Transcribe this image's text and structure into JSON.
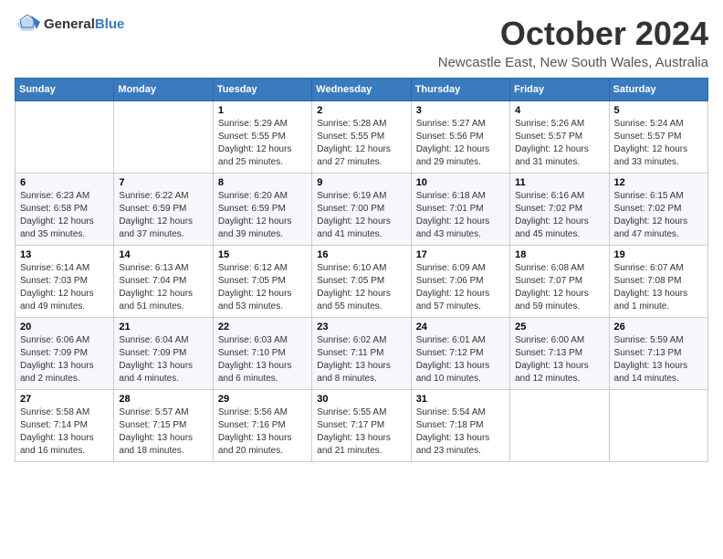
{
  "header": {
    "logo_general": "General",
    "logo_blue": "Blue",
    "month_title": "October 2024",
    "location": "Newcastle East, New South Wales, Australia"
  },
  "columns": [
    "Sunday",
    "Monday",
    "Tuesday",
    "Wednesday",
    "Thursday",
    "Friday",
    "Saturday"
  ],
  "weeks": [
    [
      {
        "day": "",
        "details": ""
      },
      {
        "day": "",
        "details": ""
      },
      {
        "day": "1",
        "details": "Sunrise: 5:29 AM\nSunset: 5:55 PM\nDaylight: 12 hours and 25 minutes."
      },
      {
        "day": "2",
        "details": "Sunrise: 5:28 AM\nSunset: 5:55 PM\nDaylight: 12 hours and 27 minutes."
      },
      {
        "day": "3",
        "details": "Sunrise: 5:27 AM\nSunset: 5:56 PM\nDaylight: 12 hours and 29 minutes."
      },
      {
        "day": "4",
        "details": "Sunrise: 5:26 AM\nSunset: 5:57 PM\nDaylight: 12 hours and 31 minutes."
      },
      {
        "day": "5",
        "details": "Sunrise: 5:24 AM\nSunset: 5:57 PM\nDaylight: 12 hours and 33 minutes."
      }
    ],
    [
      {
        "day": "6",
        "details": "Sunrise: 6:23 AM\nSunset: 6:58 PM\nDaylight: 12 hours and 35 minutes."
      },
      {
        "day": "7",
        "details": "Sunrise: 6:22 AM\nSunset: 6:59 PM\nDaylight: 12 hours and 37 minutes."
      },
      {
        "day": "8",
        "details": "Sunrise: 6:20 AM\nSunset: 6:59 PM\nDaylight: 12 hours and 39 minutes."
      },
      {
        "day": "9",
        "details": "Sunrise: 6:19 AM\nSunset: 7:00 PM\nDaylight: 12 hours and 41 minutes."
      },
      {
        "day": "10",
        "details": "Sunrise: 6:18 AM\nSunset: 7:01 PM\nDaylight: 12 hours and 43 minutes."
      },
      {
        "day": "11",
        "details": "Sunrise: 6:16 AM\nSunset: 7:02 PM\nDaylight: 12 hours and 45 minutes."
      },
      {
        "day": "12",
        "details": "Sunrise: 6:15 AM\nSunset: 7:02 PM\nDaylight: 12 hours and 47 minutes."
      }
    ],
    [
      {
        "day": "13",
        "details": "Sunrise: 6:14 AM\nSunset: 7:03 PM\nDaylight: 12 hours and 49 minutes."
      },
      {
        "day": "14",
        "details": "Sunrise: 6:13 AM\nSunset: 7:04 PM\nDaylight: 12 hours and 51 minutes."
      },
      {
        "day": "15",
        "details": "Sunrise: 6:12 AM\nSunset: 7:05 PM\nDaylight: 12 hours and 53 minutes."
      },
      {
        "day": "16",
        "details": "Sunrise: 6:10 AM\nSunset: 7:05 PM\nDaylight: 12 hours and 55 minutes."
      },
      {
        "day": "17",
        "details": "Sunrise: 6:09 AM\nSunset: 7:06 PM\nDaylight: 12 hours and 57 minutes."
      },
      {
        "day": "18",
        "details": "Sunrise: 6:08 AM\nSunset: 7:07 PM\nDaylight: 12 hours and 59 minutes."
      },
      {
        "day": "19",
        "details": "Sunrise: 6:07 AM\nSunset: 7:08 PM\nDaylight: 13 hours and 1 minute."
      }
    ],
    [
      {
        "day": "20",
        "details": "Sunrise: 6:06 AM\nSunset: 7:09 PM\nDaylight: 13 hours and 2 minutes."
      },
      {
        "day": "21",
        "details": "Sunrise: 6:04 AM\nSunset: 7:09 PM\nDaylight: 13 hours and 4 minutes."
      },
      {
        "day": "22",
        "details": "Sunrise: 6:03 AM\nSunset: 7:10 PM\nDaylight: 13 hours and 6 minutes."
      },
      {
        "day": "23",
        "details": "Sunrise: 6:02 AM\nSunset: 7:11 PM\nDaylight: 13 hours and 8 minutes."
      },
      {
        "day": "24",
        "details": "Sunrise: 6:01 AM\nSunset: 7:12 PM\nDaylight: 13 hours and 10 minutes."
      },
      {
        "day": "25",
        "details": "Sunrise: 6:00 AM\nSunset: 7:13 PM\nDaylight: 13 hours and 12 minutes."
      },
      {
        "day": "26",
        "details": "Sunrise: 5:59 AM\nSunset: 7:13 PM\nDaylight: 13 hours and 14 minutes."
      }
    ],
    [
      {
        "day": "27",
        "details": "Sunrise: 5:58 AM\nSunset: 7:14 PM\nDaylight: 13 hours and 16 minutes."
      },
      {
        "day": "28",
        "details": "Sunrise: 5:57 AM\nSunset: 7:15 PM\nDaylight: 13 hours and 18 minutes."
      },
      {
        "day": "29",
        "details": "Sunrise: 5:56 AM\nSunset: 7:16 PM\nDaylight: 13 hours and 20 minutes."
      },
      {
        "day": "30",
        "details": "Sunrise: 5:55 AM\nSunset: 7:17 PM\nDaylight: 13 hours and 21 minutes."
      },
      {
        "day": "31",
        "details": "Sunrise: 5:54 AM\nSunset: 7:18 PM\nDaylight: 13 hours and 23 minutes."
      },
      {
        "day": "",
        "details": ""
      },
      {
        "day": "",
        "details": ""
      }
    ]
  ]
}
